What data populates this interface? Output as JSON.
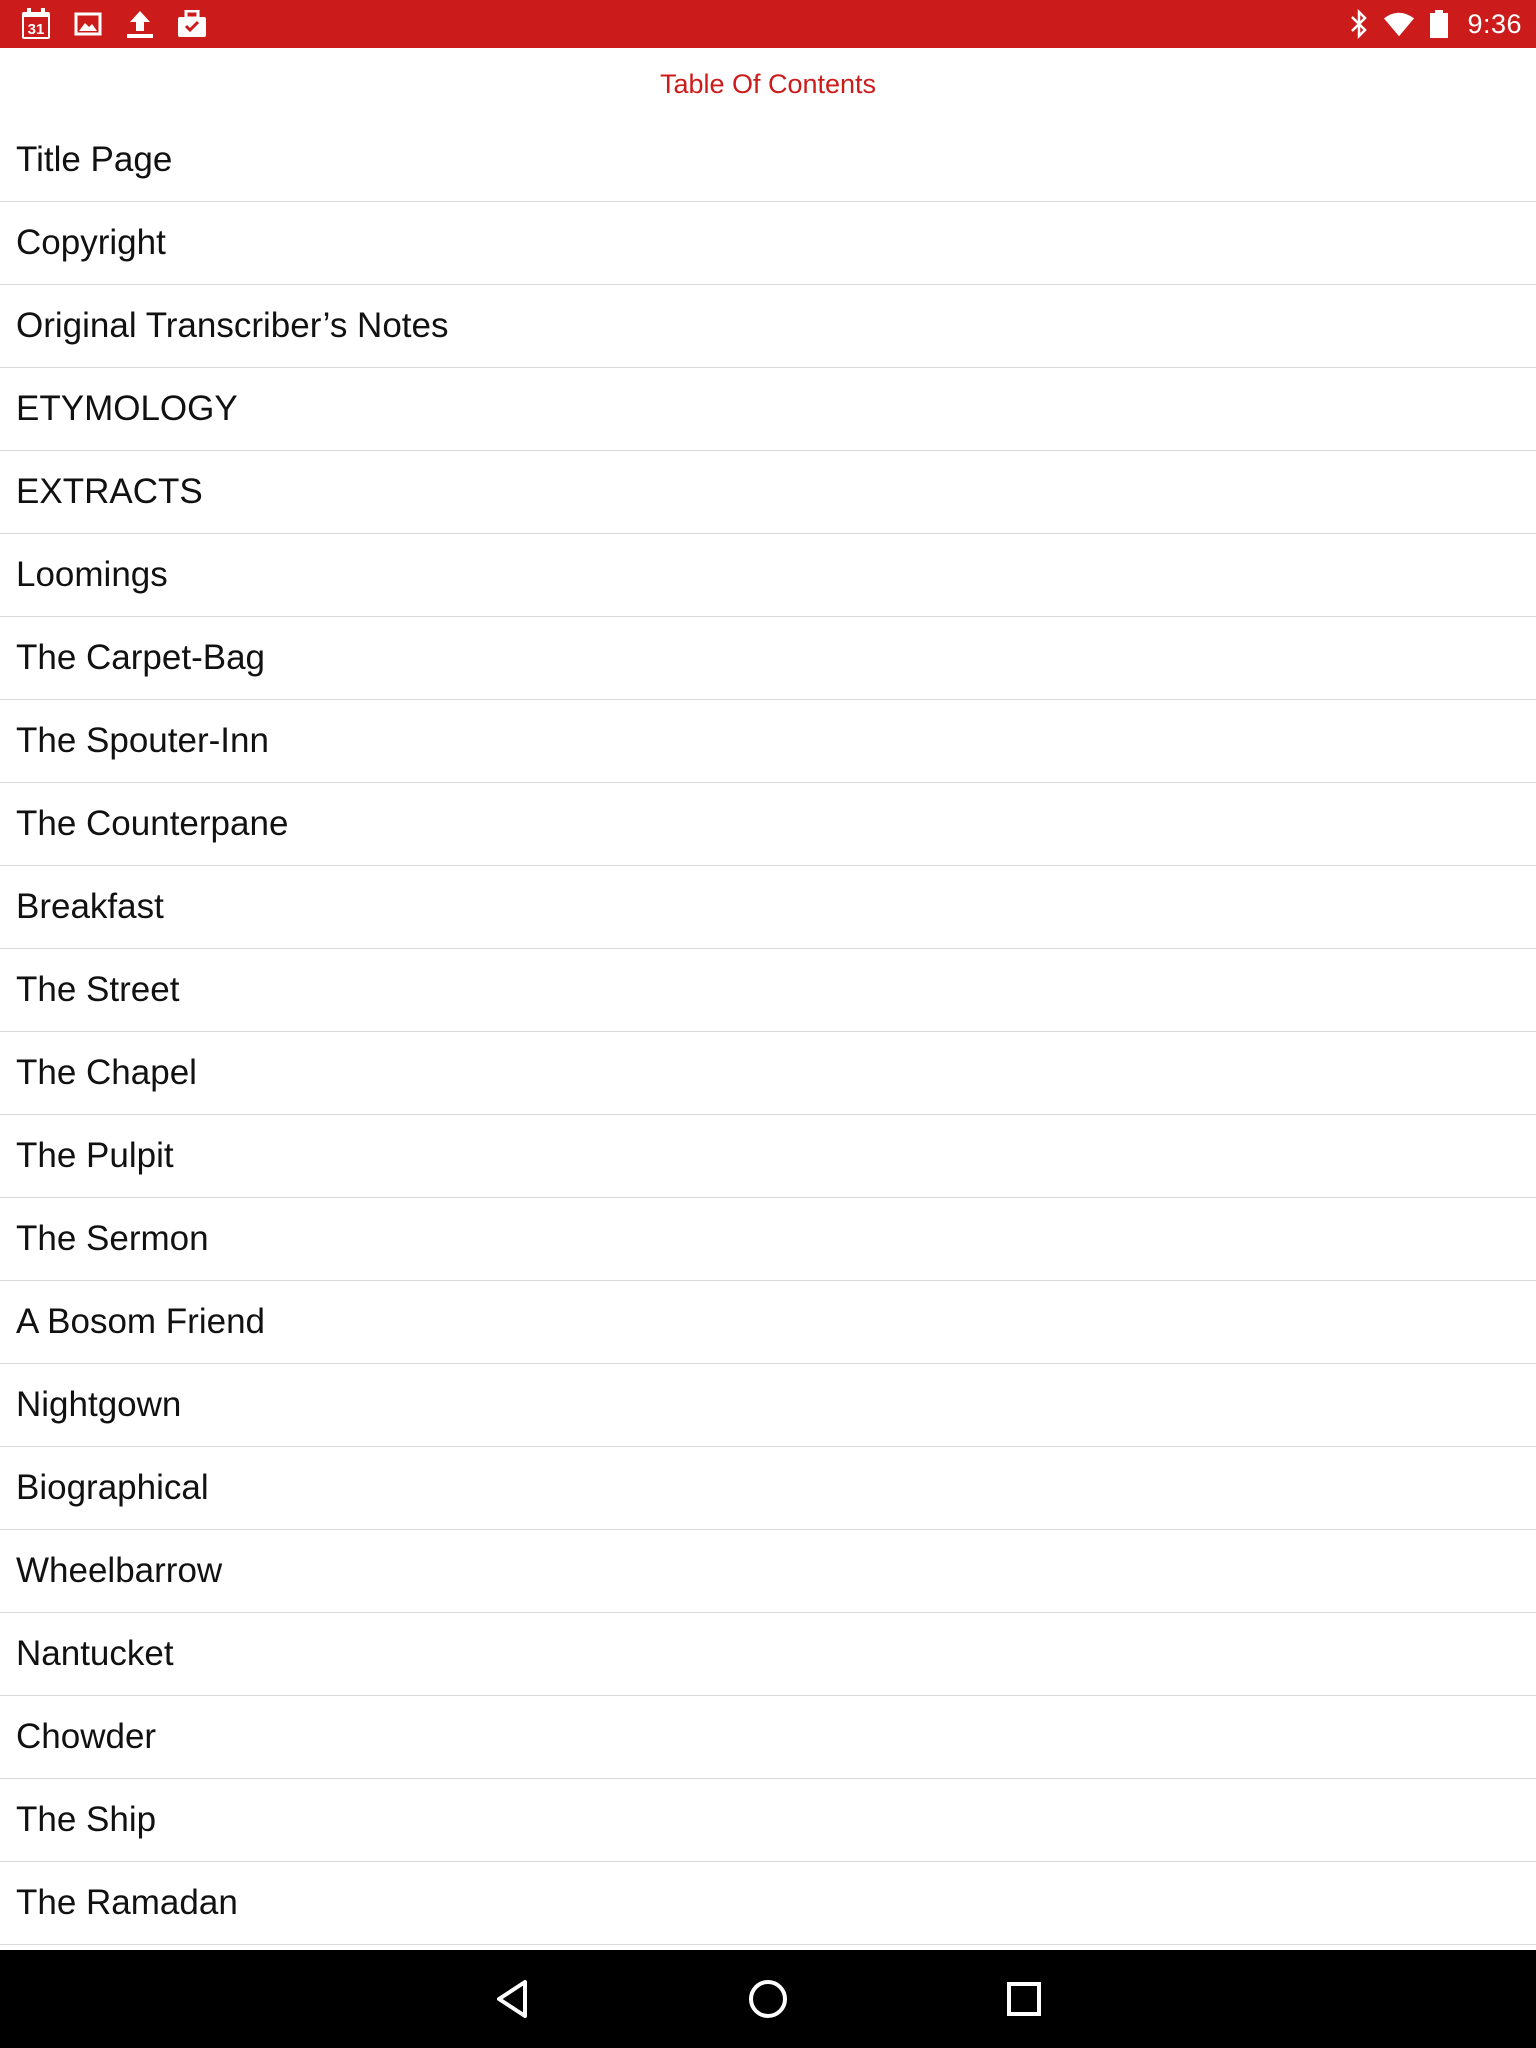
{
  "status_bar": {
    "background": "#cc1b1b",
    "left_icons": [
      "calendar-icon",
      "image-icon",
      "upload-icon",
      "briefcase-check-icon"
    ],
    "calendar_day": "31",
    "right_icons": [
      "bluetooth-icon",
      "wifi-icon",
      "battery-icon"
    ],
    "time": "9:36"
  },
  "header": {
    "title": "Table Of Contents",
    "accent_color": "#cc1b1b"
  },
  "toc": {
    "items": [
      "Title Page",
      "Copyright",
      "Original Transcriber’s Notes",
      "ETYMOLOGY",
      "EXTRACTS",
      "Loomings",
      "The Carpet-Bag",
      "The Spouter-Inn",
      "The Counterpane",
      "Breakfast",
      "The Street",
      "The Chapel",
      "The Pulpit",
      "The Sermon",
      "A Bosom Friend",
      "Nightgown",
      "Biographical",
      "Wheelbarrow",
      "Nantucket",
      "Chowder",
      "The Ship",
      "The Ramadan"
    ]
  },
  "nav_bar": {
    "buttons": [
      "back-icon",
      "home-icon",
      "recents-icon"
    ]
  }
}
